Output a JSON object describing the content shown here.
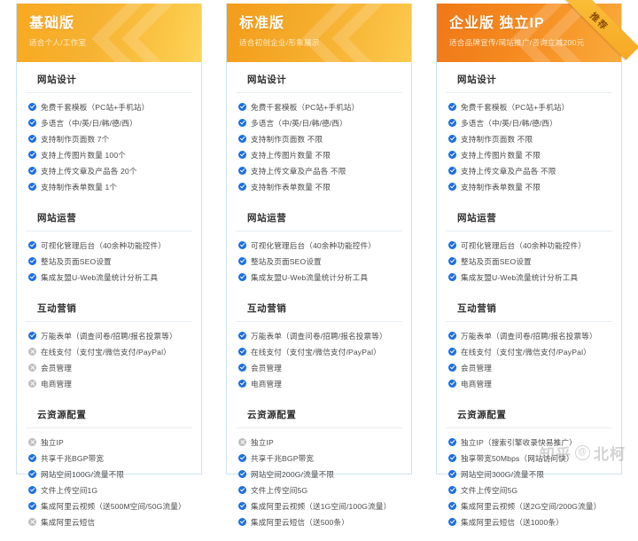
{
  "watermark": {
    "brand": "知乎",
    "at_symbol": "@",
    "user": "北柯"
  },
  "plans": [
    {
      "title": "基础版",
      "subtitle": "适合个人/工作室",
      "badge": "",
      "sections": [
        {
          "title": "网站设计",
          "items": [
            {
              "text": "免费千套模板（PC站+手机站）",
              "included": true
            },
            {
              "text": "多语言（中/英/日/韩/德/西）",
              "included": true
            },
            {
              "text": "支持制作页面数  7个",
              "included": true
            },
            {
              "text": "支持上传图片数量  100个",
              "included": true
            },
            {
              "text": "支持上传文章及产品各  20个",
              "included": true
            },
            {
              "text": "支持制作表单数量  1个",
              "included": true
            }
          ]
        },
        {
          "title": "网站运营",
          "items": [
            {
              "text": "可视化管理后台（40余种功能控件）",
              "included": true
            },
            {
              "text": "整站及页面SEO设置",
              "included": true
            },
            {
              "text": "集成友盟U-Web流量统计分析工具",
              "included": true
            }
          ]
        },
        {
          "title": "互动营销",
          "items": [
            {
              "text": "万能表单（调查问卷/招聘/报名投票等）",
              "included": true
            },
            {
              "text": "在线支付（支付宝/微信支付/PayPal）",
              "included": false
            },
            {
              "text": "会员管理",
              "included": false
            },
            {
              "text": "电商管理",
              "included": false
            }
          ]
        },
        {
          "title": "云资源配置",
          "items": [
            {
              "text": "独立IP",
              "included": false
            },
            {
              "text": "共享千兆BGP带宽",
              "included": true
            },
            {
              "text": "网站空间100G/流量不限",
              "included": true
            },
            {
              "text": "文件上传空间1G",
              "included": true
            },
            {
              "text": "集成阿里云视频（送500M空间/50G流量）",
              "included": true
            },
            {
              "text": "集成阿里云短信",
              "included": false
            }
          ]
        }
      ]
    },
    {
      "title": "标准版",
      "subtitle": "适合初创企业/形象展示",
      "badge": "",
      "sections": [
        {
          "title": "网站设计",
          "items": [
            {
              "text": "免费千套模板（PC站+手机站）",
              "included": true
            },
            {
              "text": "多语言（中/英/日/韩/德/西）",
              "included": true
            },
            {
              "text": "支持制作页面数  不限",
              "included": true
            },
            {
              "text": "支持上传图片数量  不限",
              "included": true
            },
            {
              "text": "支持上传文章及产品各  不限",
              "included": true
            },
            {
              "text": "支持制作表单数量  不限",
              "included": true
            }
          ]
        },
        {
          "title": "网站运营",
          "items": [
            {
              "text": "可视化管理后台（40余种功能控件）",
              "included": true
            },
            {
              "text": "整站及页面SEO设置",
              "included": true
            },
            {
              "text": "集成友盟U-Web流量统计分析工具",
              "included": true
            }
          ]
        },
        {
          "title": "互动营销",
          "items": [
            {
              "text": "万能表单（调查问卷/招聘/报名投票等）",
              "included": true
            },
            {
              "text": "在线支付（支付宝/微信支付/PayPal）",
              "included": true
            },
            {
              "text": "会员管理",
              "included": true
            },
            {
              "text": "电商管理",
              "included": true
            }
          ]
        },
        {
          "title": "云资源配置",
          "items": [
            {
              "text": "独立IP",
              "included": false
            },
            {
              "text": "共享千兆BGP带宽",
              "included": true
            },
            {
              "text": "网站空间200G/流量不限",
              "included": true
            },
            {
              "text": "文件上传空间5G",
              "included": true
            },
            {
              "text": "集成阿里云视频（送1G空间/100G流量）",
              "included": true
            },
            {
              "text": "集成阿里云短信（送500条）",
              "included": true
            }
          ]
        }
      ]
    },
    {
      "title": "企业版 独立IP",
      "subtitle": "适合品牌宣传/网站推广/咨询立减200元",
      "badge": "推荐",
      "sections": [
        {
          "title": "网站设计",
          "items": [
            {
              "text": "免费千套模板（PC站+手机站）",
              "included": true
            },
            {
              "text": "多语言（中/英/日/韩/德/西）",
              "included": true
            },
            {
              "text": "支持制作页面数  不限",
              "included": true
            },
            {
              "text": "支持上传图片数量  不限",
              "included": true
            },
            {
              "text": "支持上传文章及产品各  不限",
              "included": true
            },
            {
              "text": "支持制作表单数量  不限",
              "included": true
            }
          ]
        },
        {
          "title": "网站运营",
          "items": [
            {
              "text": "可视化管理后台（40余种功能控件）",
              "included": true
            },
            {
              "text": "整站及页面SEO设置",
              "included": true
            },
            {
              "text": "集成友盟U-Web流量统计分析工具",
              "included": true
            }
          ]
        },
        {
          "title": "互动营销",
          "items": [
            {
              "text": "万能表单（调查问卷/招聘/报名投票等）",
              "included": true
            },
            {
              "text": "在线支付（支付宝/微信支付/PayPal）",
              "included": true
            },
            {
              "text": "会员管理",
              "included": true
            },
            {
              "text": "电商管理",
              "included": true
            }
          ]
        },
        {
          "title": "云资源配置",
          "items": [
            {
              "text": "独立IP（搜索引擎收录快易推广）",
              "included": true
            },
            {
              "text": "独享带宽50Mbps（网站访问快）",
              "included": true
            },
            {
              "text": "网站空间300G/流量不限",
              "included": true
            },
            {
              "text": "文件上传空间5G",
              "included": true
            },
            {
              "text": "集成阿里云视频（送2G空间/200G流量）",
              "included": true
            },
            {
              "text": "集成阿里云短信（送1000条）",
              "included": true
            }
          ]
        }
      ]
    }
  ]
}
